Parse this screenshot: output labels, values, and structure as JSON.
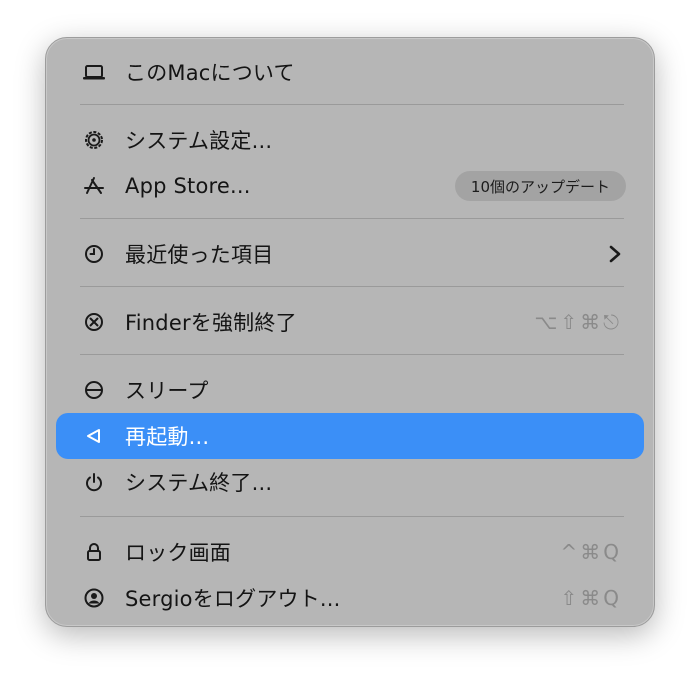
{
  "menu": {
    "items": [
      {
        "label": "このMacについて",
        "icon": "laptop-icon"
      },
      {
        "label": "システム設定...",
        "icon": "gear-icon"
      },
      {
        "label": "App Store...",
        "icon": "app-store-icon",
        "badge": "10個のアップデート"
      },
      {
        "label": "最近使った項目",
        "icon": "clock-icon",
        "submenu": true
      },
      {
        "label": "Finderを強制終了",
        "icon": "force-quit-icon",
        "shortcut": "⌥⇧⌘⎋"
      },
      {
        "label": "スリープ",
        "icon": "sleep-icon"
      },
      {
        "label": "再起動...",
        "icon": "restart-icon",
        "selected": true
      },
      {
        "label": "システム終了...",
        "icon": "power-icon"
      },
      {
        "label": "ロック画面",
        "icon": "lock-icon",
        "shortcut": "^⌘Q"
      },
      {
        "label": "Sergioをログアウト...",
        "icon": "user-icon",
        "shortcut": "⇧⌘Q"
      }
    ]
  },
  "colors": {
    "menu_background": "#b6b6b6",
    "selection": "#3b8ff7",
    "text": "#141414",
    "shortcut_text": "#8a8a8a"
  }
}
